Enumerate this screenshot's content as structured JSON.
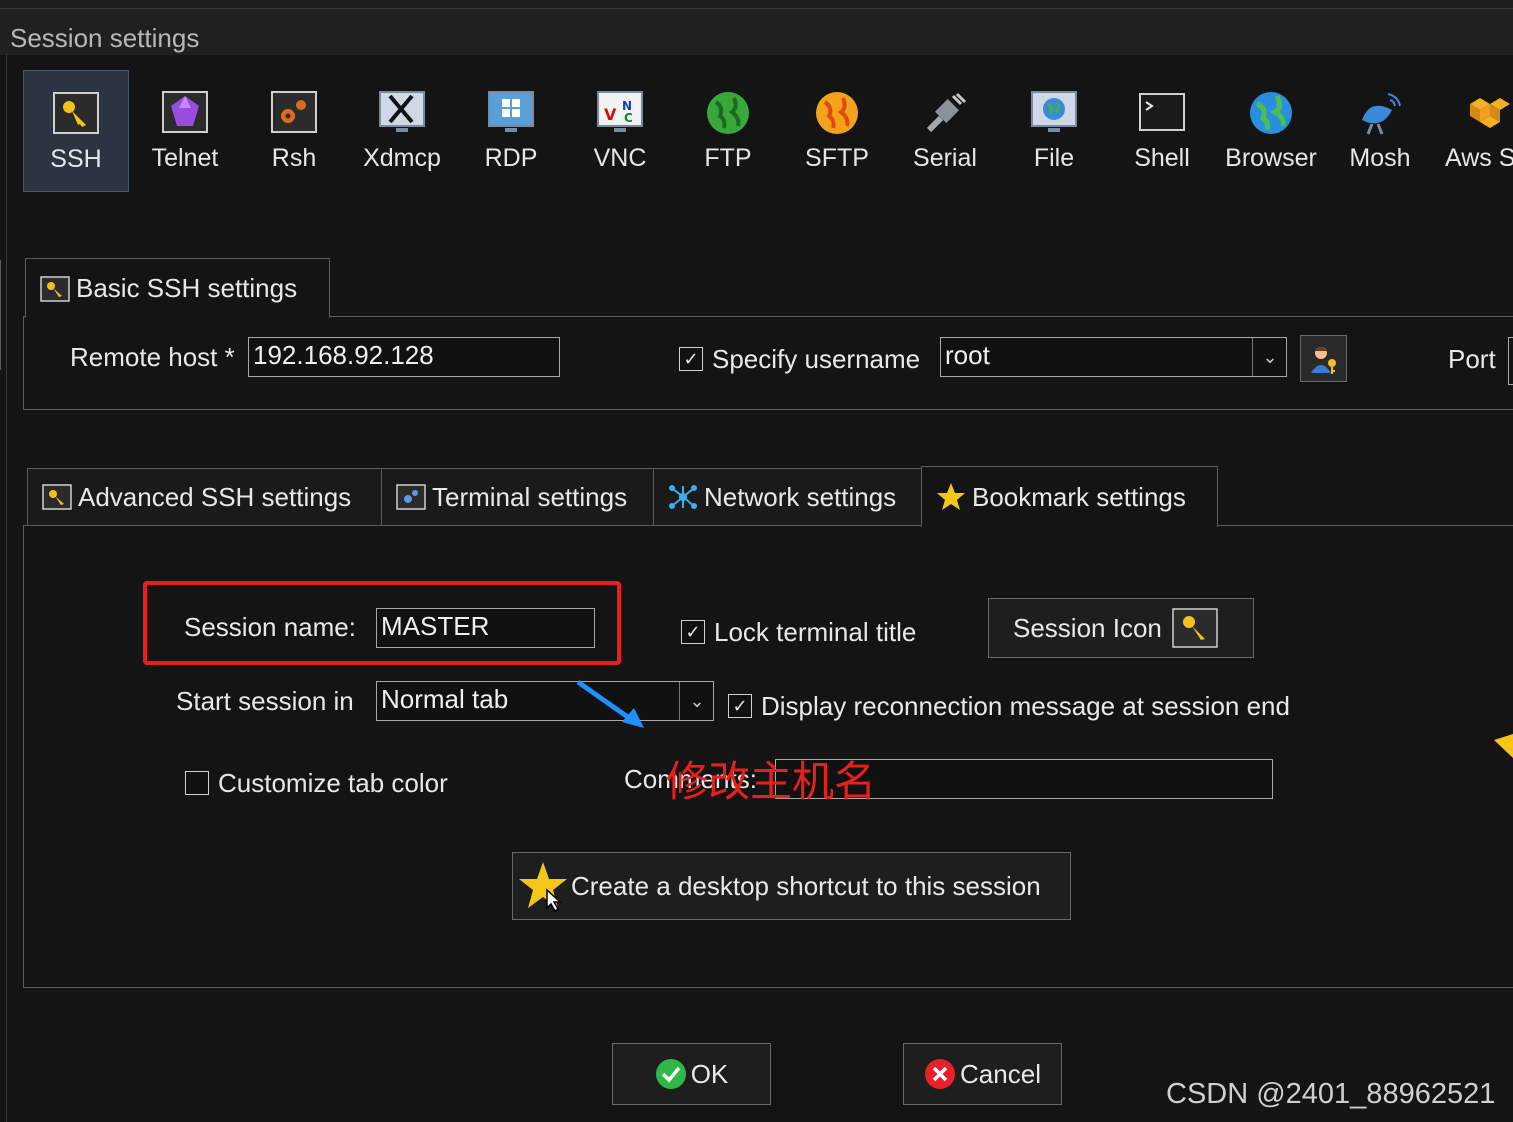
{
  "window": {
    "title": "Session settings"
  },
  "protocols": [
    {
      "label": "SSH",
      "icon": "ssh-key-icon",
      "selected": true
    },
    {
      "label": "Telnet",
      "icon": "telnet-gem-icon"
    },
    {
      "label": "Rsh",
      "icon": "rsh-gears-icon"
    },
    {
      "label": "Xdmcp",
      "icon": "xdmcp-x-monitor-icon"
    },
    {
      "label": "RDP",
      "icon": "rdp-windows-monitor-icon"
    },
    {
      "label": "VNC",
      "icon": "vnc-monitor-icon"
    },
    {
      "label": "FTP",
      "icon": "ftp-globe-icon"
    },
    {
      "label": "SFTP",
      "icon": "sftp-globe-icon"
    },
    {
      "label": "Serial",
      "icon": "serial-plug-icon"
    },
    {
      "label": "File",
      "icon": "file-monitor-globe-icon"
    },
    {
      "label": "Shell",
      "icon": "shell-terminal-icon"
    },
    {
      "label": "Browser",
      "icon": "browser-globe-icon"
    },
    {
      "label": "Mosh",
      "icon": "mosh-satellite-icon"
    },
    {
      "label": "Aws S",
      "icon": "aws-cubes-icon"
    }
  ],
  "basic": {
    "tab_label": "Basic SSH settings",
    "remote_host_label": "Remote host *",
    "remote_host_value": "192.168.92.128",
    "specify_username_label": "Specify username",
    "specify_username_checked": true,
    "username_value": "root",
    "port_label": "Port"
  },
  "tabs": [
    {
      "label": "Advanced SSH settings",
      "icon": "key-icon"
    },
    {
      "label": "Terminal settings",
      "icon": "terminal-gear-icon"
    },
    {
      "label": "Network settings",
      "icon": "network-icon"
    },
    {
      "label": "Bookmark settings",
      "icon": "star-icon",
      "active": true
    }
  ],
  "bookmark": {
    "session_name_label": "Session name:",
    "session_name_value": "MASTER",
    "lock_title_label": "Lock terminal title",
    "lock_title_checked": true,
    "session_icon_label": "Session Icon",
    "start_session_label": "Start session in",
    "start_session_value": "Normal tab",
    "reconnect_label": "Display reconnection message at session end",
    "reconnect_checked": true,
    "custom_tab_color_label": "Customize tab color",
    "custom_tab_color_checked": false,
    "comments_label": "Comments:",
    "comments_value": "",
    "shortcut_label": "Create a desktop shortcut to this session"
  },
  "annotation": {
    "text": "修改主机名",
    "color": "#e8201a",
    "arrow_color": "#1e90ff"
  },
  "footer": {
    "ok_label": "OK",
    "cancel_label": "Cancel",
    "watermark": "CSDN @2401_88962521"
  }
}
